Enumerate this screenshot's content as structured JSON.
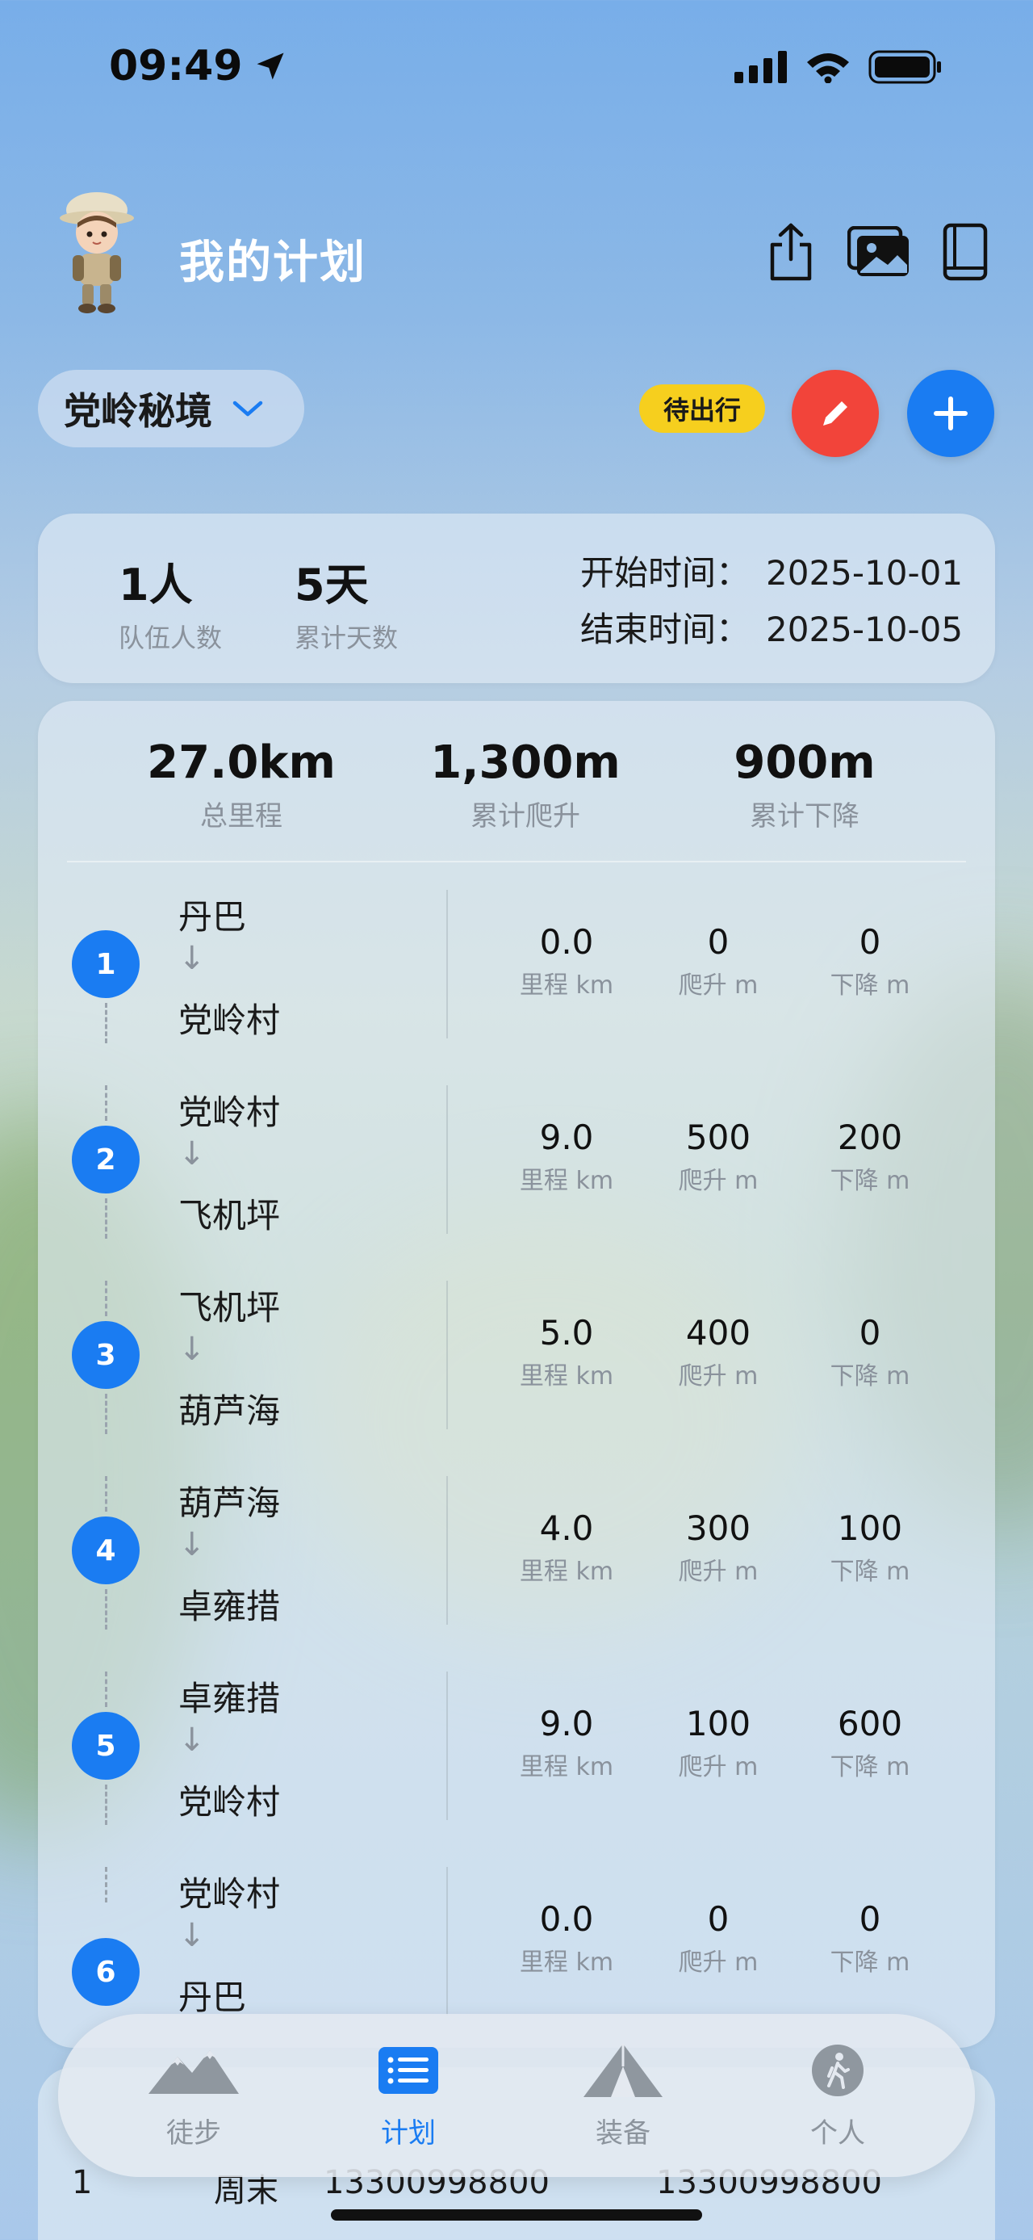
{
  "status_bar": {
    "time": "09:49"
  },
  "header": {
    "title": "我的计划"
  },
  "plan": {
    "name": "党岭秘境",
    "status": "待出行"
  },
  "team": {
    "people_value": "1人",
    "people_label": "队伍人数",
    "days_value": "5天",
    "days_label": "累计天数",
    "start_label": "开始时间：",
    "start_date": "2025-10-01",
    "end_label": "结束时间：",
    "end_date": "2025-10-05"
  },
  "summary": {
    "distance_value": "27.0km",
    "distance_label": "总里程",
    "ascent_value": "1,300m",
    "ascent_label": "累计爬升",
    "descent_value": "900m",
    "descent_label": "累计下降"
  },
  "metric_labels": {
    "distance": "里程 km",
    "ascent": "爬升 m",
    "descent": "下降 m"
  },
  "arrow": "↓",
  "stages": [
    {
      "num": "1",
      "from": "丹巴",
      "to": "党岭村",
      "distance": "0.0",
      "ascent": "0",
      "descent": "0"
    },
    {
      "num": "2",
      "from": "党岭村",
      "to": "飞机坪",
      "distance": "9.0",
      "ascent": "500",
      "descent": "200"
    },
    {
      "num": "3",
      "from": "飞机坪",
      "to": "葫芦海",
      "distance": "5.0",
      "ascent": "400",
      "descent": "0"
    },
    {
      "num": "4",
      "from": "葫芦海",
      "to": "卓雍措",
      "distance": "4.0",
      "ascent": "300",
      "descent": "100"
    },
    {
      "num": "5",
      "from": "卓雍措",
      "to": "党岭村",
      "distance": "9.0",
      "ascent": "100",
      "descent": "600"
    },
    {
      "num": "6",
      "from": "党岭村",
      "to": "丹巴",
      "distance": "0.0",
      "ascent": "0",
      "descent": "0"
    }
  ],
  "contact_row": {
    "index": "1",
    "name": "周末",
    "phone1": "13300998800",
    "phone2": "13300998800"
  },
  "tabs": [
    {
      "label": "徒步",
      "icon": "mountain-icon"
    },
    {
      "label": "计划",
      "icon": "list-icon"
    },
    {
      "label": "装备",
      "icon": "tent-icon"
    },
    {
      "label": "个人",
      "icon": "hiker-icon"
    }
  ],
  "colors": {
    "accent": "#1a7cf2",
    "edit": "#f2443a",
    "badge": "#f6cf1e"
  }
}
